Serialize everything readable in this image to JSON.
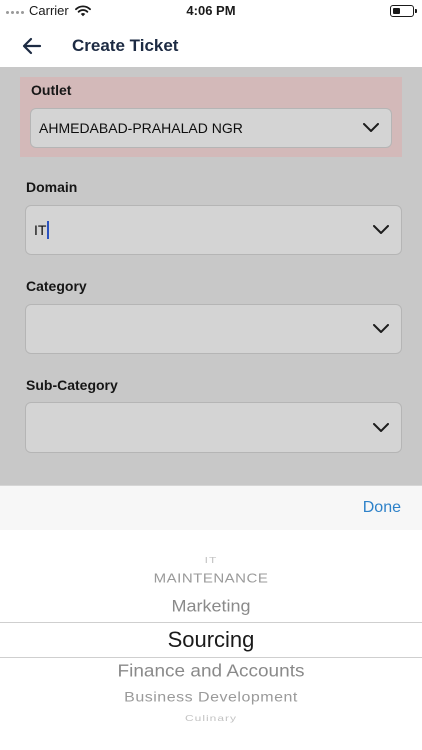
{
  "status_bar": {
    "carrier": "Carrier",
    "time": "4:06 PM",
    "battery_level": 0.4
  },
  "nav": {
    "title": "Create Ticket"
  },
  "form": {
    "outlet": {
      "label": "Outlet",
      "value": "AHMEDABAD-PRAHALAD NGR"
    },
    "domain": {
      "label": "Domain",
      "value": "IT"
    },
    "category": {
      "label": "Category",
      "value": ""
    },
    "sub_category": {
      "label": "Sub-Category",
      "value": ""
    }
  },
  "picker": {
    "done_label": "Done",
    "options": [
      "IT",
      "MAINTENANCE",
      "Marketing",
      "Sourcing",
      "Finance and Accounts",
      "Business Development",
      "Culinary"
    ],
    "selected": "Sourcing"
  },
  "colors": {
    "accent": "#2e82c9",
    "highlight": "#f1d3d3",
    "title": "#1d2b43"
  },
  "icons": {
    "back": "arrow-left-icon",
    "dropdown": "chevron-down-icon",
    "wifi": "wifi-icon",
    "battery": "battery-icon"
  }
}
